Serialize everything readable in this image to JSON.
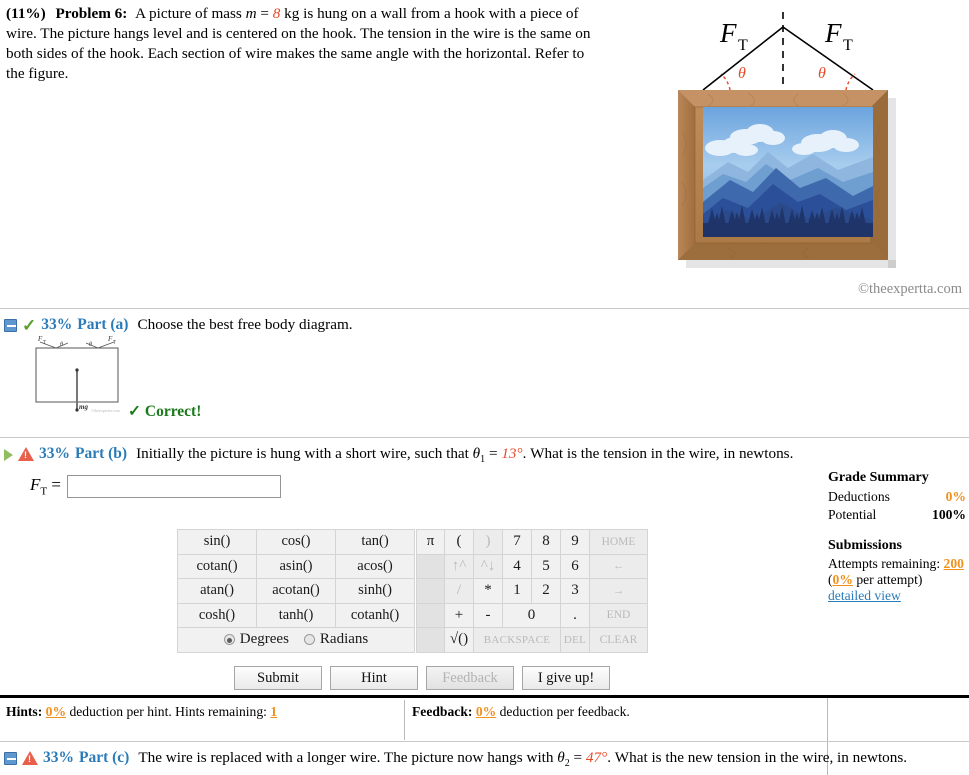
{
  "problem": {
    "percent": "(11%)",
    "number": "Problem 6:",
    "text_p1": "A picture of mass ",
    "mass_var": "m",
    "eq": " = ",
    "mass_val": "8",
    "text_p2": " kg is hung on a wall from a hook with a piece of wire. The picture hangs level and is centered on the hook. The tension in the wire is the same on both sides of the hook. Each section of wire makes the same angle with the horizontal. Refer to the figure."
  },
  "figure": {
    "force_label_left": "F",
    "force_sub_left": "T",
    "force_label_right": "F",
    "force_sub_right": "T",
    "angle_left": "θ",
    "angle_right": "θ",
    "watermark": "©theexpertta.com",
    "frame_color": "#b5824f",
    "sky_top_color": "#7fb0e0",
    "mountain_color": "#2b5099"
  },
  "parts": [
    {
      "id": "a",
      "percent": "33%",
      "label": "Part (a)",
      "text": "Choose the best free body diagram.",
      "status": "correct",
      "status_text": "Correct!",
      "icon_left": "collapse-box-icon",
      "icon_status": "green-check-icon"
    },
    {
      "id": "b",
      "percent": "33%",
      "label": "Part (b)",
      "text_pre": "Initially the picture is hung with a short wire, such that ",
      "theta_var": "θ",
      "theta_sub": "1",
      "theta_eq": " = ",
      "theta_val": "13°",
      "text_post": ". What is the tension in the wire, in newtons.",
      "icon_left": "expand-triangle-icon",
      "icon_status": "red-warning-icon"
    },
    {
      "id": "c",
      "percent": "33%",
      "label": "Part (c)",
      "text_pre": "The wire is replaced with a longer wire. The picture now hangs with ",
      "theta_var": "θ",
      "theta_sub": "2",
      "theta_eq": " = ",
      "theta_val": "47°",
      "text_post": ". What is the new tension in the wire, in newtons.",
      "icon_left": "collapse-box-icon",
      "icon_status": "red-warning-icon"
    }
  ],
  "fbd_thumbnail": {
    "force_left": "F",
    "force_left_sub": "T",
    "force_right": "F",
    "force_right_sub": "T",
    "angle_left": "θ",
    "angle_right": "θ",
    "weight_label": "mg",
    "watermark": "©theexpertta.com"
  },
  "answer": {
    "label_main": "F",
    "label_sub": "T",
    "label_eq": "=",
    "value": "",
    "placeholder": ""
  },
  "keypad": {
    "functions": [
      [
        "sin()",
        "cos()",
        "tan()"
      ],
      [
        "cotan()",
        "asin()",
        "acos()"
      ],
      [
        "atan()",
        "acotan()",
        "sinh()"
      ],
      [
        "cosh()",
        "tanh()",
        "cotanh()"
      ]
    ],
    "angle_mode": {
      "degrees_label": "Degrees",
      "radians_label": "Radians",
      "selected": "Degrees"
    },
    "numeric_rows": [
      [
        {
          "t": "π",
          "s": "active",
          "w": "w-pi"
        },
        {
          "t": "(",
          "s": "active",
          "w": "w-op"
        },
        {
          "t": ")",
          "s": "dim",
          "w": "w-op"
        },
        {
          "t": "7",
          "s": "active",
          "w": "w-dig"
        },
        {
          "t": "8",
          "s": "active",
          "w": "w-dig"
        },
        {
          "t": "9",
          "s": "active",
          "w": "w-dig"
        },
        {
          "t": "HOME",
          "s": "dim",
          "w": "w-nav"
        }
      ],
      [
        {
          "t": "",
          "s": "blank",
          "w": "w-pi"
        },
        {
          "t": "↑^",
          "s": "dim",
          "w": "w-op"
        },
        {
          "t": "^↓",
          "s": "dim",
          "w": "w-op"
        },
        {
          "t": "4",
          "s": "active",
          "w": "w-dig"
        },
        {
          "t": "5",
          "s": "active",
          "w": "w-dig"
        },
        {
          "t": "6",
          "s": "active",
          "w": "w-dig"
        },
        {
          "t": "←",
          "s": "dim",
          "w": "w-nav"
        }
      ],
      [
        {
          "t": "",
          "s": "blank",
          "w": "w-pi"
        },
        {
          "t": "/",
          "s": "dim",
          "w": "w-op"
        },
        {
          "t": "*",
          "s": "active",
          "w": "w-op"
        },
        {
          "t": "1",
          "s": "active",
          "w": "w-dig"
        },
        {
          "t": "2",
          "s": "active",
          "w": "w-dig"
        },
        {
          "t": "3",
          "s": "active",
          "w": "w-dig"
        },
        {
          "t": "→",
          "s": "dim",
          "w": "w-nav"
        }
      ],
      [
        {
          "t": "",
          "s": "blank",
          "w": "w-pi"
        },
        {
          "t": "+",
          "s": "active",
          "w": "w-op"
        },
        {
          "t": "-",
          "s": "active",
          "w": "w-op"
        },
        {
          "t": "0",
          "s": "active",
          "w": "w-dig",
          "colspan": 2
        },
        {
          "t": ".",
          "s": "active",
          "w": "w-dig"
        },
        {
          "t": "END",
          "s": "dim",
          "w": "w-nav"
        }
      ],
      [
        {
          "t": "",
          "s": "blank",
          "w": "w-pi"
        },
        {
          "t": "√()",
          "s": "active",
          "w": "w-op"
        },
        {
          "t": "BACKSPACE",
          "s": "dim wide",
          "w": "w-dig",
          "colspan": 3
        },
        {
          "t": "DEL",
          "s": "dim wide",
          "w": "w-dig"
        },
        {
          "t": "CLEAR",
          "s": "dim",
          "w": "w-nav"
        }
      ]
    ]
  },
  "buttons": {
    "submit": "Submit",
    "hint": "Hint",
    "feedback": "Feedback",
    "give_up": "I give up!"
  },
  "grade_summary": {
    "title": "Grade Summary",
    "deductions_label": "Deductions",
    "deductions_value": "0%",
    "potential_label": "Potential",
    "potential_value": "100%",
    "submissions_title": "Submissions",
    "attempts_label": "Attempts remaining:",
    "attempts_value": "200",
    "per_attempt_pct": "0%",
    "per_attempt_text": " per attempt)",
    "per_attempt_open": "(",
    "detailed_view": "detailed view"
  },
  "hints_bar": {
    "hints_label": "Hints:",
    "hints_pct": "0%",
    "hints_text": "deduction per hint. Hints remaining:",
    "hints_remaining": "1",
    "feedback_label": "Feedback:",
    "feedback_pct": "0%",
    "feedback_text": "deduction per feedback."
  }
}
